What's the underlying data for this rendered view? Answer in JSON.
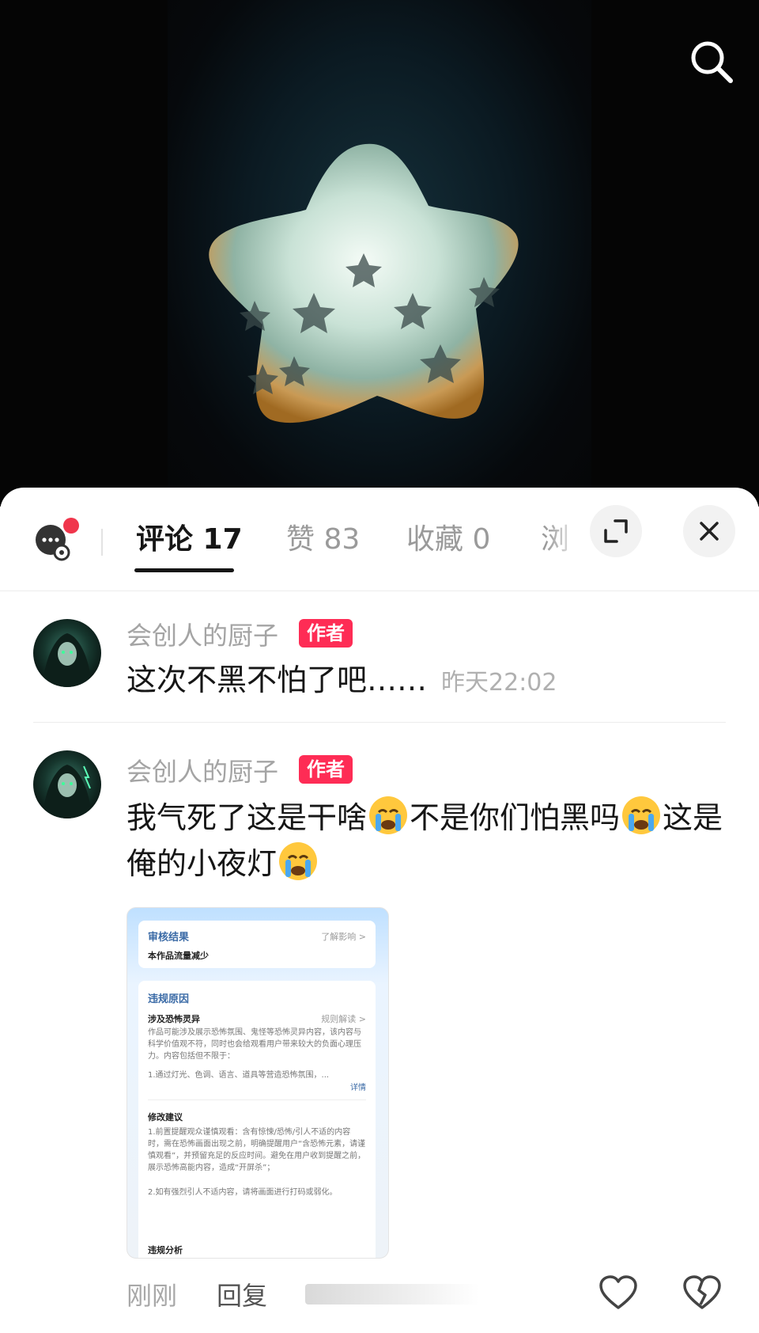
{
  "top": {
    "search_icon": "search-icon"
  },
  "tabs": [
    {
      "label": "评论 17"
    },
    {
      "label": "赞 83"
    },
    {
      "label": "收藏 0"
    },
    {
      "label": "浏"
    }
  ],
  "header_icons": {
    "messages": "chat-bubble-icon",
    "expand": "expand-icon",
    "close": "close-icon"
  },
  "colors": {
    "accent": "#fe2c55",
    "badge": "#fe2c55",
    "active_tab": "#161616"
  },
  "comments": [
    {
      "user": "会创人的厨子",
      "badge": "作者",
      "text": "这次不黑不怕了吧……",
      "time": "昨天22:02"
    },
    {
      "user": "会创人的厨子",
      "badge": "作者",
      "text_parts": [
        "我气死了这是干啥",
        "不是你们怕黑吗",
        "这是俺的小夜灯"
      ],
      "emoji": "crying-face-emoji"
    }
  ],
  "screenshot": {
    "card1_title": "审核结果",
    "card1_link": "了解影响 >",
    "card1_body": "本作品流量减少",
    "card2_title": "违规原因",
    "card2_sub": "涉及恐怖灵异",
    "card2_link": "规则解读 >",
    "card2_body": "作品可能涉及展示恐怖氛围、鬼怪等恐怖灵异内容，该内容与科学价值观不符，同时也会给观看用户带来较大的负面心理压力。内容包括但不限于：",
    "card2_item": "1.通过灯光、色调、语言、道具等营造恐怖氛围，...",
    "card2_more": "详情",
    "card3_title": "修改建议",
    "card3_body1": "1.前置提醒观众谨慎观看：含有惊悚/恐怖/引人不适的内容时，需在恐怖画面出现之前，明确提醒用户“含恐怖元素，请谨慎观看”，并预留充足的反应时间。避免在用户收到提醒之前，展示恐怖高能内容，造成“开屏杀”；",
    "card3_body2": "2.如有强烈引人不适内容，请将画面进行打码或弱化。",
    "card4_title": "违规分析"
  },
  "actions": {
    "time": "刚刚",
    "reply": "回复",
    "like_icon": "heart-icon",
    "dislike_icon": "broken-heart-icon"
  }
}
